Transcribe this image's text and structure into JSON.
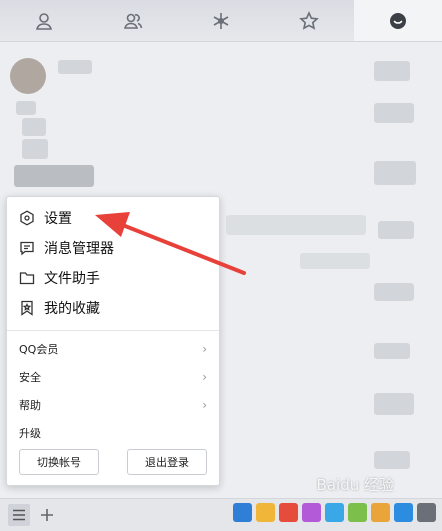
{
  "tabs": [
    {
      "icon": "contact-icon"
    },
    {
      "icon": "group-icon"
    },
    {
      "icon": "apps-icon"
    },
    {
      "icon": "star-icon"
    },
    {
      "icon": "message-icon",
      "active": true
    }
  ],
  "menu": {
    "items": [
      {
        "label": "设置",
        "icon": "settings-hexagon-icon"
      },
      {
        "label": "消息管理器",
        "icon": "message-manager-icon"
      },
      {
        "label": "文件助手",
        "icon": "folder-icon"
      },
      {
        "label": "我的收藏",
        "icon": "bookmark-icon"
      }
    ],
    "submenus": [
      {
        "label": "QQ会员"
      },
      {
        "label": "安全"
      },
      {
        "label": "帮助"
      },
      {
        "label": "升级"
      }
    ],
    "switch_account_label": "切换帐号",
    "logout_label": "退出登录"
  },
  "bottombar": {
    "menu_icon": "hamburger-menu-icon",
    "add_icon": "plus-icon",
    "app_icons": [
      "qq-browser-icon",
      "qq-pet-icon",
      "qq-music-icon",
      "flower-icon",
      "video-icon",
      "game-icon",
      "tencent-map-icon",
      "security-shield-icon",
      "grid-apps-icon"
    ]
  },
  "watermark": "Baidu 经验",
  "colors": {
    "arrow": "#e8413a",
    "active_tab": "#f3f4f6"
  }
}
